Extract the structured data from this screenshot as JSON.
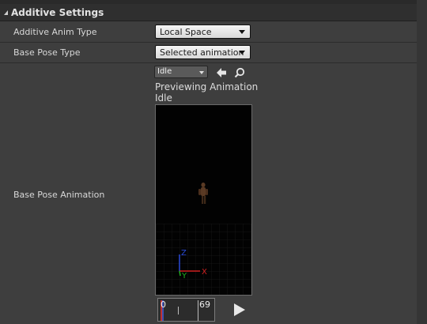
{
  "section": {
    "title": "Additive Settings"
  },
  "rows": {
    "additive_anim_type": {
      "label": "Additive Anim Type",
      "value": "Local Space"
    },
    "base_pose_type": {
      "label": "Base Pose Type",
      "value": "Selected animation"
    },
    "base_pose_animation": {
      "label": "Base Pose Animation"
    }
  },
  "asset_picker": {
    "selected": "Idle",
    "use_icon": "arrow-left-icon",
    "browse_icon": "search-icon"
  },
  "preview": {
    "line1": "Previewing Animation",
    "line2": "Idle",
    "axis_labels": {
      "x": "X",
      "y": "Y",
      "z": "Z"
    }
  },
  "timeline": {
    "start_frame": "0",
    "end_frame": "69",
    "play_icon": "play-icon"
  },
  "colors": {
    "panel_bg": "#3e3e3e",
    "header_bg": "#2f2f2f",
    "axis_x": "#d02020",
    "axis_y": "#20b020",
    "axis_z": "#2a4ad8"
  }
}
